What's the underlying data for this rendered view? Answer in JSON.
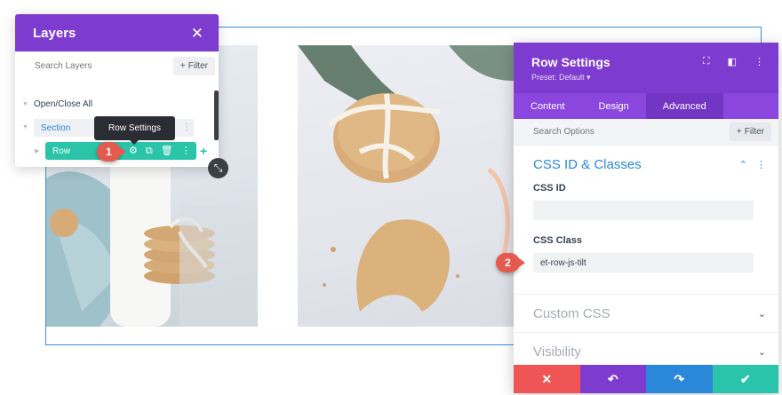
{
  "layers": {
    "title": "Layers",
    "close_icon": "✕",
    "search_placeholder": "Search Layers",
    "filter_label": "Filter",
    "open_close_all": "Open/Close All",
    "section_label": "Section",
    "row_label": "Row",
    "add_icon": "+"
  },
  "tooltip": {
    "text": "Row Settings"
  },
  "steps": {
    "one": "1",
    "two": "2"
  },
  "settings": {
    "title": "Row Settings",
    "preset": "Preset: Default ▾",
    "tabs": [
      {
        "label": "Content"
      },
      {
        "label": "Design"
      },
      {
        "label": "Advanced"
      }
    ],
    "active_tab": "Advanced",
    "search_placeholder": "Search Options",
    "filter_label": "Filter",
    "groups": {
      "css_id_classes": "CSS ID & Classes",
      "custom_css": "Custom CSS",
      "visibility": "Visibility"
    },
    "fields": {
      "css_id_label": "CSS ID",
      "css_id_value": "",
      "css_class_label": "CSS Class",
      "css_class_value": "et-row-js-tilt"
    }
  },
  "colors": {
    "purple": "#7e3bd0",
    "tab_purple": "#8a46dd",
    "teal": "#29c4a9",
    "blue": "#2b87da",
    "cancel": "#ef5555",
    "undo": "#7e3bd0",
    "redo": "#2b87da",
    "save": "#29c4a9",
    "step_badge": "#e55a4f"
  }
}
